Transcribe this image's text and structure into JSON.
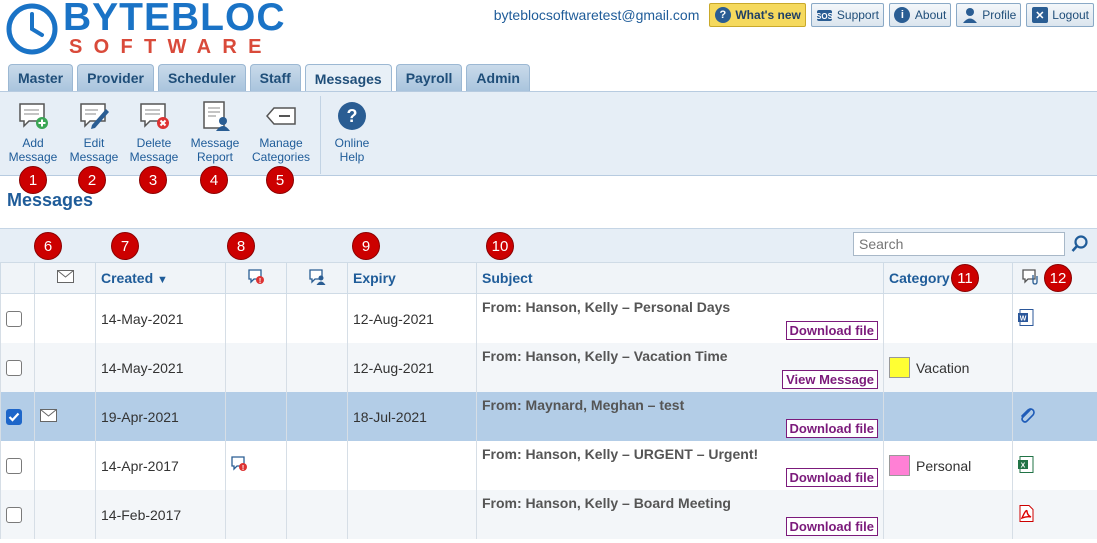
{
  "brand": {
    "name": "BYTEBLOC",
    "sub": "SOFTWARE"
  },
  "topbar": {
    "email": "byteblocsoftwaretest@gmail.com",
    "whats_new": "What's new",
    "support": "Support",
    "about": "About",
    "profile": "Profile",
    "logout": "Logout"
  },
  "tabs": [
    {
      "label": "Master"
    },
    {
      "label": "Provider"
    },
    {
      "label": "Scheduler"
    },
    {
      "label": "Staff"
    },
    {
      "label": "Messages"
    },
    {
      "label": "Payroll"
    },
    {
      "label": "Admin"
    }
  ],
  "toolbar": {
    "add": [
      "Add",
      "Message"
    ],
    "edit": [
      "Edit",
      "Message"
    ],
    "delete": [
      "Delete",
      "Message"
    ],
    "report": [
      "Message",
      "Report"
    ],
    "categories": [
      "Manage",
      "Categories"
    ],
    "help": [
      "Online",
      "Help"
    ]
  },
  "badges": [
    "1",
    "2",
    "3",
    "4",
    "5",
    "6",
    "7",
    "8",
    "9",
    "10",
    "11",
    "12"
  ],
  "page_title": "Messages",
  "search": {
    "placeholder": "Search"
  },
  "columns": {
    "created": "Created",
    "sort_arrow": "▼",
    "expiry": "Expiry",
    "subject": "Subject",
    "category": "Category"
  },
  "rows": [
    {
      "created": "14-May-2021",
      "expiry": "12-Aug-2021",
      "subject": "From: Hanson, Kelly – Personal Days",
      "action": "Download file",
      "category": "",
      "cat_color": "",
      "attach": "word"
    },
    {
      "created": "14-May-2021",
      "expiry": "12-Aug-2021",
      "subject": "From: Hanson, Kelly – Vacation Time",
      "action": "View Message",
      "category": "Vacation",
      "cat_color": "#ffff33",
      "attach": ""
    },
    {
      "created": "19-Apr-2021",
      "expiry": "18-Jul-2021",
      "subject": "From: Maynard, Meghan – test",
      "action": "Download file",
      "category": "",
      "cat_color": "",
      "attach": "paperclip"
    },
    {
      "created": "14-Apr-2017",
      "expiry": "",
      "subject": "From: Hanson, Kelly – URGENT – Urgent!",
      "action": "Download file",
      "category": "Personal",
      "cat_color": "#ff80d5",
      "attach": "excel"
    },
    {
      "created": "14-Feb-2017",
      "expiry": "",
      "subject": "From: Hanson, Kelly – Board Meeting",
      "action": "Download file",
      "category": "",
      "cat_color": "",
      "attach": "pdf"
    }
  ]
}
